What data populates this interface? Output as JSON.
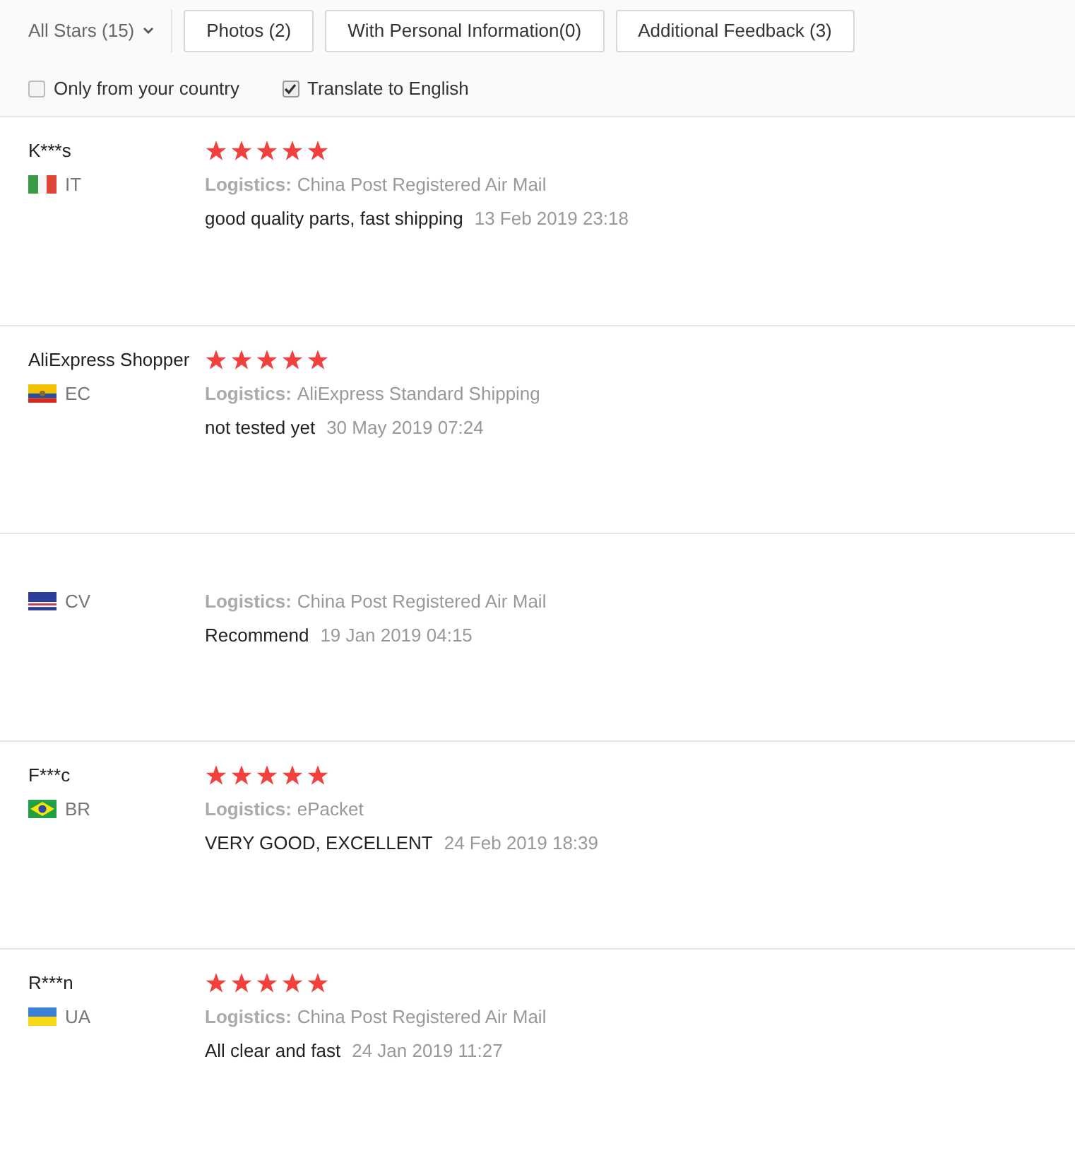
{
  "filters": {
    "dropdown": "All Stars (15)",
    "buttons": [
      "Photos (2)",
      "With Personal Information(0)",
      "Additional Feedback (3)"
    ]
  },
  "options": [
    {
      "label": "Only from your country",
      "checked": false
    },
    {
      "label": "Translate to English",
      "checked": true
    }
  ],
  "reviews": [
    {
      "name": "K***s",
      "kind": "italy",
      "country": "IT",
      "stars": 5,
      "logistics_label": "Logistics:",
      "logistics": "China Post Registered Air Mail",
      "text": "good quality parts, fast shipping",
      "date": "13 Feb 2019 23:18"
    },
    {
      "name": "AliExpress Shopper",
      "kind": "ecuador",
      "country": "EC",
      "stars": 5,
      "logistics_label": "Logistics:",
      "logistics": "AliExpress Standard Shipping",
      "text": "not tested yet",
      "date": "30 May 2019 07:24"
    },
    {
      "kind": "capeverde",
      "country": "CV",
      "logistics_label": "Logistics:",
      "logistics": "China Post Registered Air Mail",
      "text": "Recommend",
      "date": "19 Jan 2019 04:15"
    },
    {
      "name": "F***c",
      "kind": "brazil",
      "country": "BR",
      "stars": 5,
      "logistics_label": "Logistics:",
      "logistics": "ePacket",
      "text": "VERY GOOD, EXCELLENT",
      "date": "24 Feb 2019 18:39"
    },
    {
      "name": "R***n",
      "kind": "ukraine",
      "country": "UA",
      "stars": 5,
      "logistics_label": "Logistics:",
      "logistics": "China Post Registered Air Mail",
      "text": "All clear and fast",
      "date": "24 Jan 2019 11:27"
    }
  ]
}
